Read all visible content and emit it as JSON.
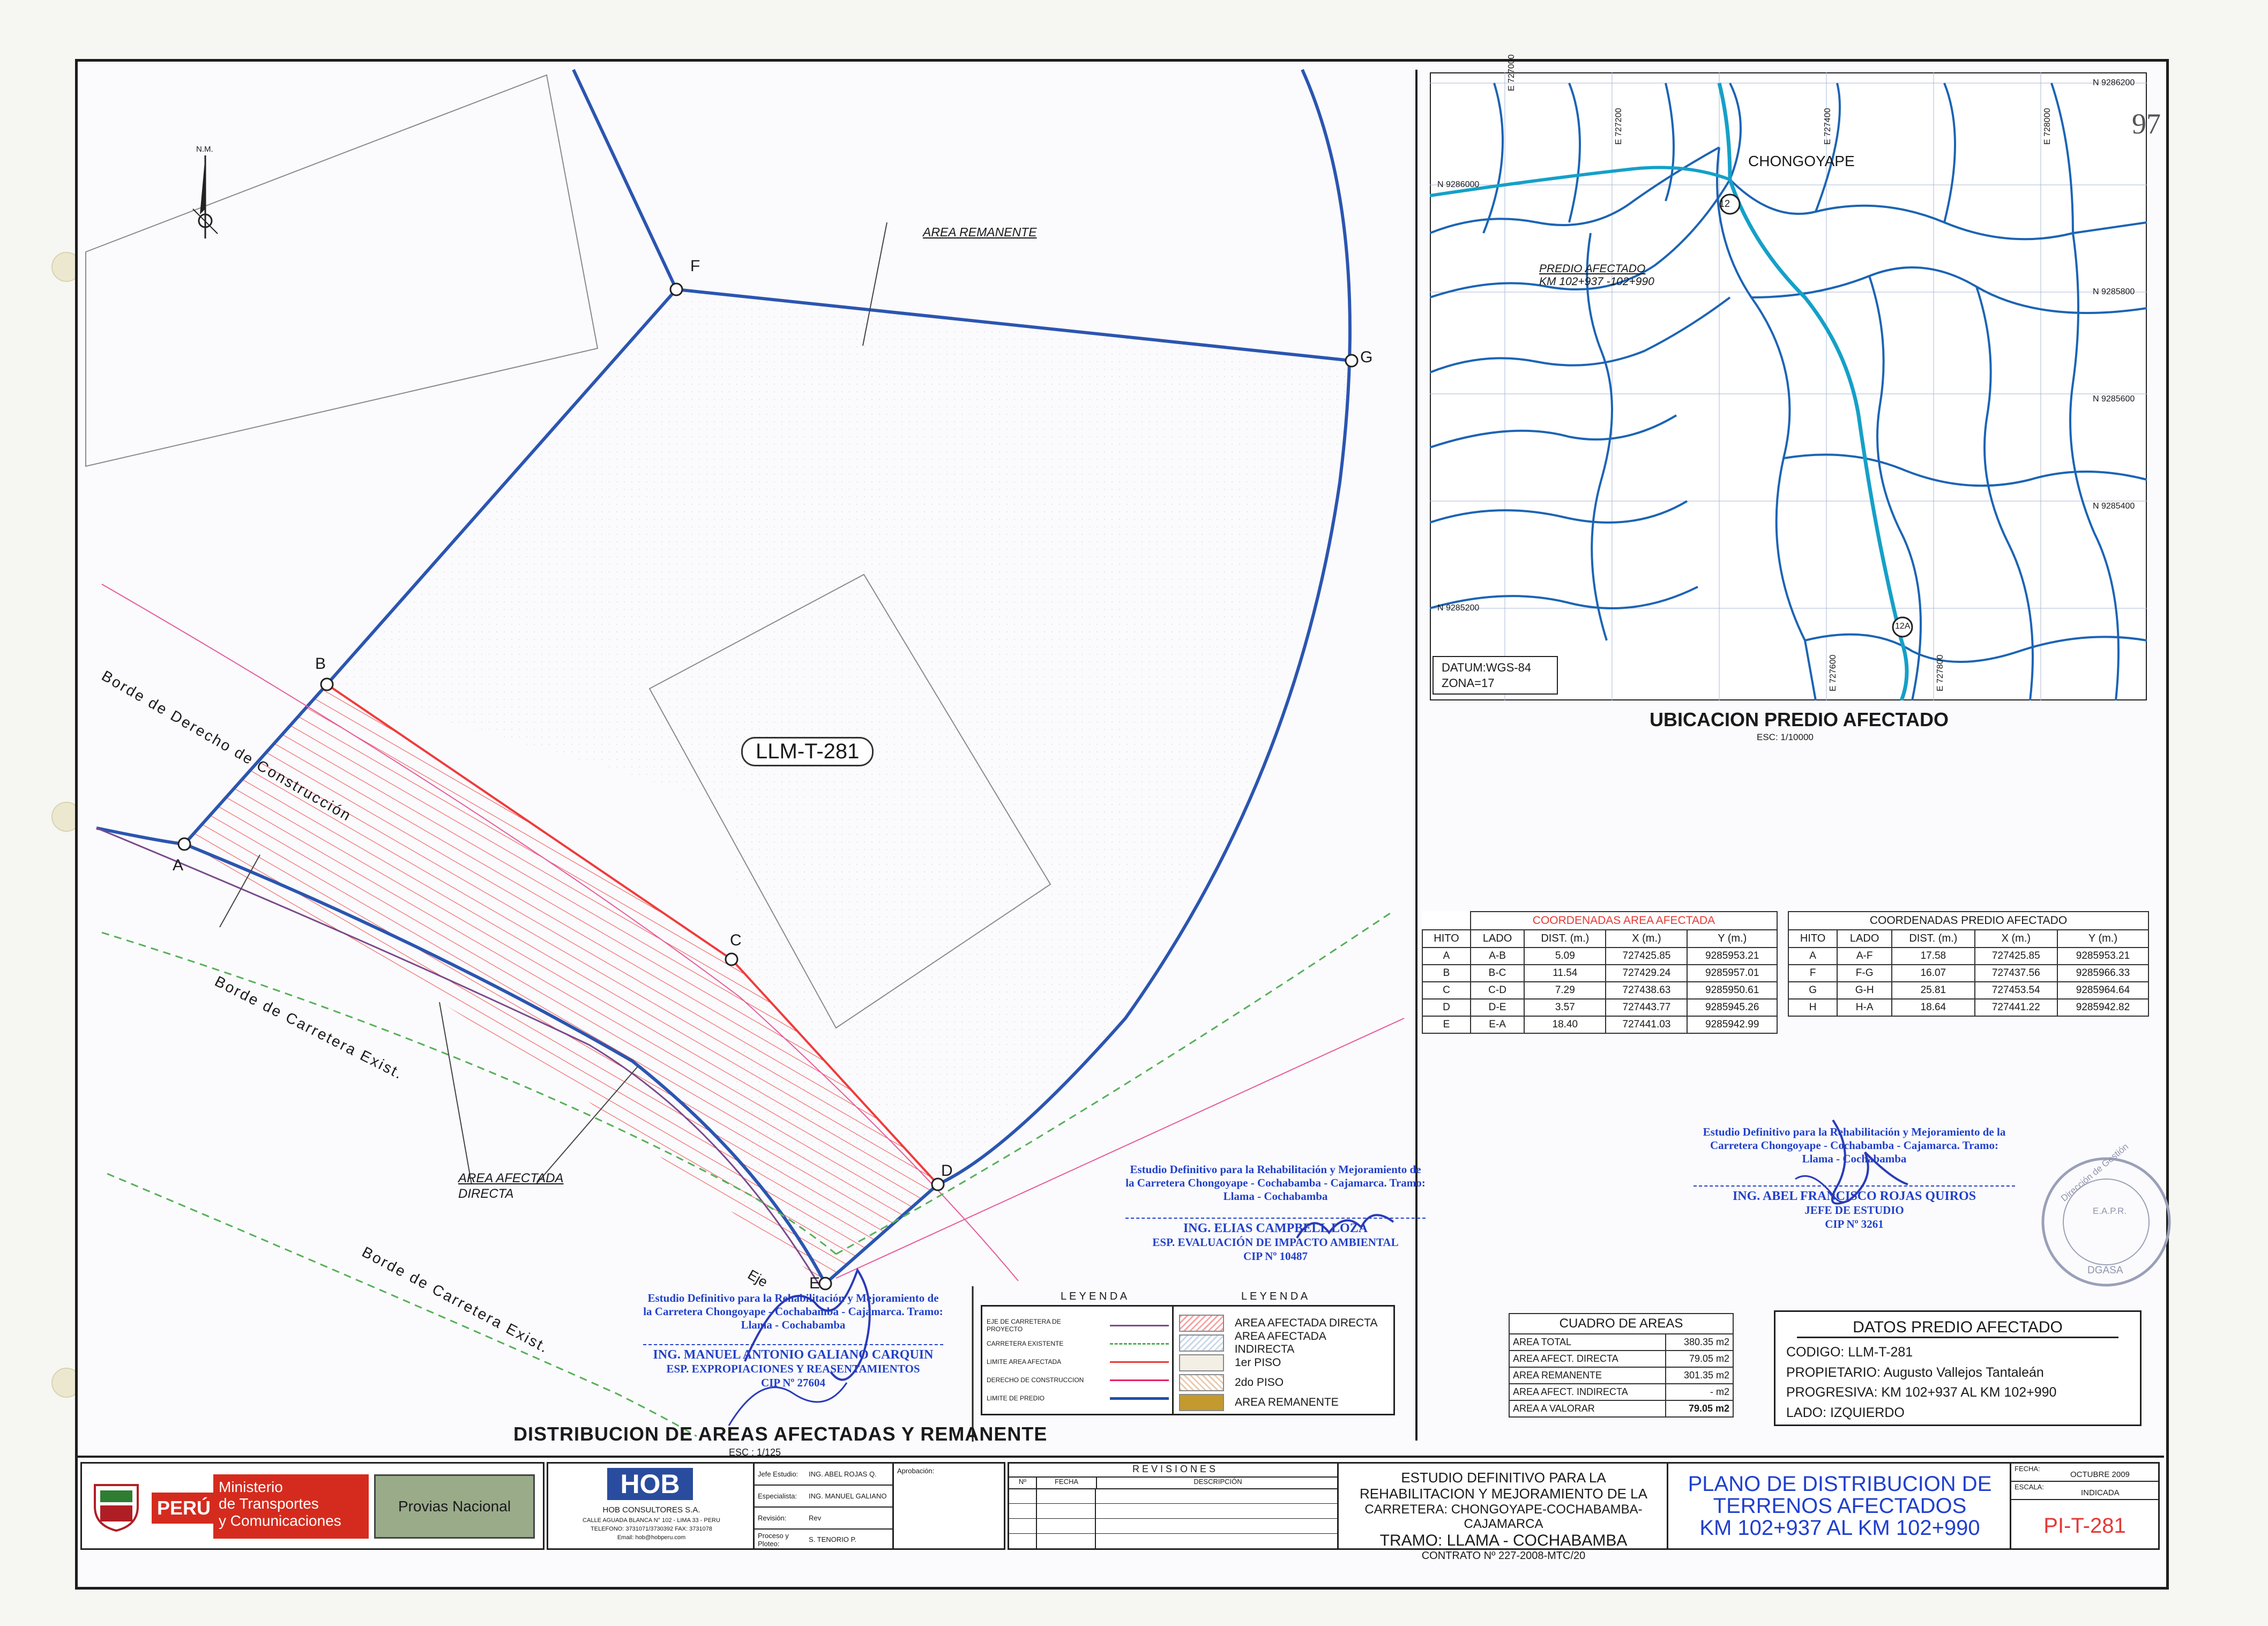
{
  "main_map": {
    "north_label": "N.M.",
    "points": {
      "A": "A",
      "B": "B",
      "C": "C",
      "D": "D",
      "E": "E",
      "F": "F",
      "G": "G"
    },
    "area_remanente_label": "AREA REMANENTE",
    "parcel_code": "LLM-T-281",
    "borde_derecho": "Borde de Derecho de Construcción",
    "borde_carretera_1": "Borde de Carretera Exist.",
    "borde_carretera_2": "Borde de Carretera Exist.",
    "area_afectada_label_1": "AREA AFECTADA",
    "area_afectada_label_2": "DIRECTA",
    "eje_label": "Eje",
    "title": "DISTRIBUCION DE AREAS AFECTADAS Y REMANENTE",
    "scale": "ESC : 1/125"
  },
  "location_map": {
    "town": "CHONGOYAPE",
    "predio_label_1": "PREDIO AFECTADO",
    "predio_label_2": "KM 102+937 -102+990",
    "datum": "DATUM:WGS-84",
    "zona": "ZONA=17",
    "title": "UBICACION PREDIO AFECTADO",
    "scale": "ESC: 1/10000",
    "north_ticks": [
      "N 9286200",
      "N 9286000",
      "N 9285800",
      "N 9285600",
      "N 9285400",
      "N 9285200"
    ],
    "east_ticks": [
      "E 727000",
      "E 727200",
      "E 727400",
      "E 727600",
      "E 727800",
      "E 728000"
    ],
    "sheet_mark": "97",
    "road_marker_1": "12",
    "road_marker_2": "12A"
  },
  "coord_afectada": {
    "title": "COORDENADAS AREA AFECTADA",
    "headers": [
      "HITO",
      "LADO",
      "DIST. (m.)",
      "X (m.)",
      "Y (m.)"
    ],
    "rows": [
      [
        "A",
        "A-B",
        "5.09",
        "727425.85",
        "9285953.21"
      ],
      [
        "B",
        "B-C",
        "11.54",
        "727429.24",
        "9285957.01"
      ],
      [
        "C",
        "C-D",
        "7.29",
        "727438.63",
        "9285950.61"
      ],
      [
        "D",
        "D-E",
        "3.57",
        "727443.77",
        "9285945.26"
      ],
      [
        "E",
        "E-A",
        "18.40",
        "727441.03",
        "9285942.99"
      ]
    ]
  },
  "coord_predio": {
    "title": "COORDENADAS PREDIO AFECTADO",
    "headers": [
      "HITO",
      "LADO",
      "DIST. (m.)",
      "X (m.)",
      "Y (m.)"
    ],
    "rows": [
      [
        "A",
        "A-F",
        "17.58",
        "727425.85",
        "9285953.21"
      ],
      [
        "F",
        "F-G",
        "16.07",
        "727437.56",
        "9285966.33"
      ],
      [
        "G",
        "G-H",
        "25.81",
        "727453.54",
        "9285964.64"
      ],
      [
        "H",
        "H-A",
        "18.64",
        "727441.22",
        "9285942.82"
      ]
    ]
  },
  "signatures": {
    "s1_study": "Estudio Definitivo para la Rehabilitación y Mejoramiento de la Carretera Chongoyape - Cochabamba - Cajamarca. Tramo: Llama - Cochabamba",
    "s1_name": "ING. ABEL FRANCISCO ROJAS QUIROS",
    "s1_role": "JEFE DE ESTUDIO",
    "s1_cip": "CIP Nº 3261",
    "s2_study": "Estudio Definitivo para la Rehabilitación y Mejoramiento de la Carretera Chongoyape - Cochabamba - Cajamarca. Tramo: Llama - Cochabamba",
    "s2_name": "ING. ELIAS CAMPBELL LOZA",
    "s2_role": "ESP. EVALUACIÓN DE IMPACTO AMBIENTAL",
    "s2_cip": "CIP Nº 10487",
    "s3_study": "Estudio Definitivo para la Rehabilitación y Mejoramiento de la Carretera Chongoyape - Cochabamba - Cajamarca. Tramo: Llama - Cochabamba",
    "s3_name": "ING. MANUEL ANTONIO GALIANO CARQUIN",
    "s3_role": "ESP. EXPROPIACIONES Y REASENTAMIENTOS",
    "s3_cip": "CIP Nº 27604",
    "seal_1": "Dirección de Gestión",
    "seal_2": "E.A.P.R.",
    "seal_3": "DGASA"
  },
  "leyenda_lines": {
    "title": "L E Y E N D A",
    "items": [
      "EJE DE CARRETERA DE PROYECTO",
      "CARRETERA EXISTENTE",
      "LIMITE AREA AFECTADA",
      "DERECHO DE CONSTRUCCION",
      "LIMITE DE PREDIO"
    ],
    "colors": [
      "#7a4a8a",
      "#4caf50",
      "#e53935",
      "#e91e63",
      "#1f4fa8"
    ]
  },
  "leyenda_areas": {
    "title": "L E Y E N D A",
    "items": [
      "AREA AFECTADA DIRECTA",
      "AREA AFECTADA INDIRECTA",
      "1er PISO",
      "2do PISO",
      "AREA REMANENTE"
    ]
  },
  "cuadro_areas": {
    "title": "CUADRO DE AREAS",
    "rows": [
      [
        "AREA TOTAL",
        "380.35 m2"
      ],
      [
        "AREA AFECT. DIRECTA",
        "79.05 m2"
      ],
      [
        "AREA REMANENTE",
        "301.35 m2"
      ],
      [
        "AREA AFECT. INDIRECTA",
        "- m2"
      ],
      [
        "AREA A VALORAR",
        "79.05 m2"
      ]
    ]
  },
  "datos_predio": {
    "title": "DATOS PREDIO AFECTADO",
    "codigo": "CODIGO: LLM-T-281",
    "propietario": "PROPIETARIO: Augusto Vallejos Tantaleán",
    "progresiva": "PROGRESIVA: KM 102+937 AL KM 102+990",
    "lado": "LADO: IZQUIERDO"
  },
  "title_block": {
    "peru": "PERÚ",
    "ministerio_1": "Ministerio",
    "ministerio_2": "de Transportes",
    "ministerio_3": "y Comunicaciones",
    "provias": "Provias Nacional",
    "hob_logo": "HOB",
    "hob_name": "HOB CONSULTORES S.A.",
    "hob_address": "CALLE AGUADA BLANCA N° 102 - LIMA 33 - PERU",
    "hob_phone": "TELEFONO: 3731071/3730392 FAX: 3731078",
    "hob_email": "Email: hob@hobperu.com",
    "staff": [
      [
        "Jefe Estudio:",
        "ING. ABEL ROJAS Q."
      ],
      [
        "Especialista:",
        "ING. MANUEL GALIANO"
      ],
      [
        "Revisión:",
        "Rev"
      ],
      [
        "Proceso y Ploteo:",
        "S. TENORIO P."
      ]
    ],
    "aprobacion": "Aprobación:",
    "revisiones": "R E V I S I O N E S",
    "rev_headers": [
      "Nº",
      "FECHA",
      "DESCRIPCIÓN"
    ],
    "estudio_1": "ESTUDIO DEFINITIVO PARA LA",
    "estudio_2": "REHABILITACION Y MEJORAMIENTO DE LA",
    "estudio_3": "CARRETERA: CHONGOYAPE-COCHABAMBA-CAJAMARCA",
    "estudio_4": "TRAMO: LLAMA - COCHABAMBA",
    "contrato": "CONTRATO Nº 227-2008-MTC/20",
    "plano_1": "PLANO DE DISTRIBUCION DE",
    "plano_2": "TERRENOS AFECTADOS",
    "plano_3": "KM 102+937 AL KM 102+990",
    "fecha_label": "FECHA:",
    "fecha_val": "OCTUBRE 2009",
    "escala_label": "ESCALA:",
    "escala_val": "INDICADA",
    "lamina": "PI-T-281"
  }
}
